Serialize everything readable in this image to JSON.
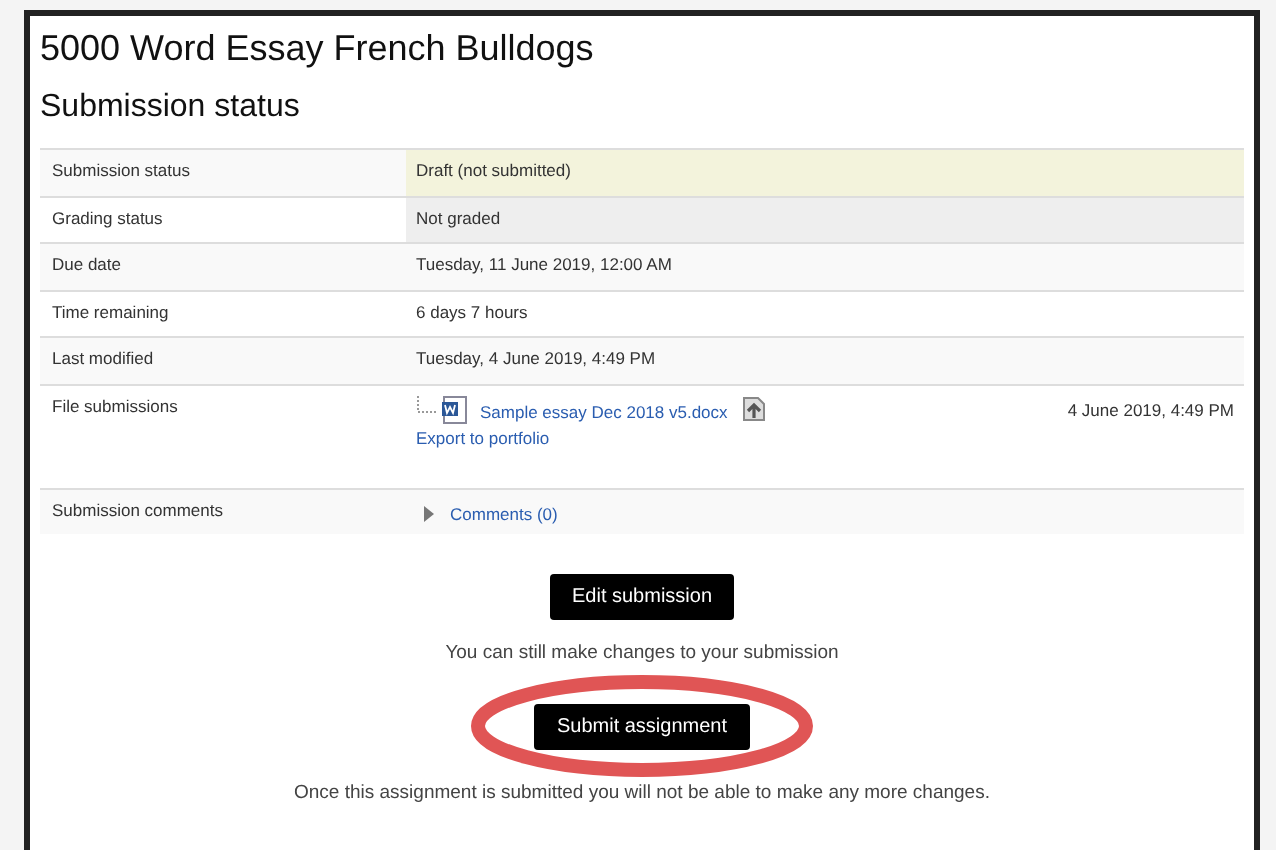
{
  "title": "5000 Word Essay French Bulldogs",
  "section_title": "Submission status",
  "rows": [
    {
      "kind": "text",
      "label": "Submission status",
      "value": "Draft (not submitted)",
      "color": "#f3f3dc"
    },
    {
      "kind": "text",
      "label": "Grading status",
      "value": "Not graded",
      "color": "#eeeeee"
    },
    {
      "kind": "text",
      "label": "Due date",
      "value": "Tuesday, 11 June 2019, 12:00 AM"
    },
    {
      "kind": "text",
      "label": "Time remaining",
      "value": "6 days 7 hours"
    },
    {
      "kind": "text",
      "label": "Last modified",
      "value": "Tuesday, 4 June 2019, 4:49 PM"
    },
    {
      "kind": "files",
      "label": "File submissions",
      "file": "Sample essay Dec 2018 v5.docx",
      "date": "4 June 2019, 4:49 PM",
      "export": "Export to portfolio"
    },
    {
      "kind": "comments",
      "label": "Submission comments",
      "link": "Comments (0)",
      "expanded": false
    }
  ],
  "actions": [
    {
      "button": "Edit submission",
      "note": "You can still make changes to your submission",
      "circled": false
    },
    {
      "button": "Submit assignment",
      "note": "Once this assignment is submitted you will not be able to make any more changes.",
      "circled": true
    }
  ]
}
